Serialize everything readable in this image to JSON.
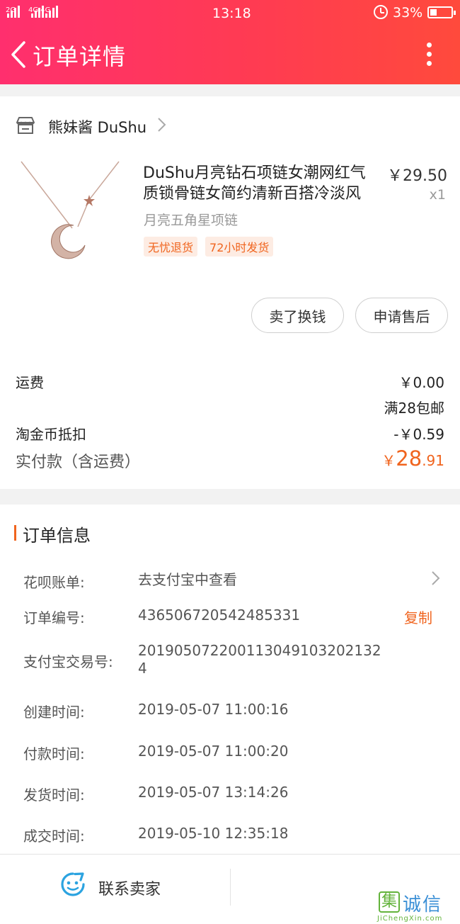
{
  "status_bar": {
    "signal_left": "2G",
    "signal_right": "4G 4G",
    "time": "13:18",
    "battery": "33%",
    "battery_level": 0.33
  },
  "header": {
    "title": "订单详情"
  },
  "shop": {
    "name": "熊妹酱 DuShu"
  },
  "product": {
    "title": "DuShu月亮钻石项链女潮网红气质锁骨链女简约清新百搭冷淡风",
    "price": "￥29.50",
    "quantity": "x1",
    "sku": "月亮五角星项链",
    "tags": [
      "无忧退货",
      "72小时发货"
    ]
  },
  "actions": {
    "sell_label": "卖了换钱",
    "after_sale_label": "申请售后"
  },
  "summary": {
    "shipping_label": "运费",
    "shipping_value": "￥0.00",
    "shipping_note": "满28包邮",
    "coin_label": "淘金币抵扣",
    "coin_value": "-￥0.59",
    "paid_label": "实付款（含运费）",
    "paid_currency": "￥",
    "paid_integer": "28",
    "paid_decimal": ".91"
  },
  "order_info": {
    "section_title": "订单信息",
    "huabei_label": "花呗账单:",
    "huabei_value": "去支付宝中查看",
    "order_no_label": "订单编号:",
    "order_no_value": "436506720542485331",
    "copy_label": "复制",
    "alipay_label": "支付宝交易号:",
    "alipay_value": "2019050722001130491032021324",
    "created_label": "创建时间:",
    "created_value": "2019-05-07 11:00:16",
    "paid_time_label": "付款时间:",
    "paid_time_value": "2019-05-07 11:00:20",
    "shipped_label": "发货时间:",
    "shipped_value": "2019-05-07 13:14:26",
    "completed_label": "成交时间:",
    "completed_value": "2019-05-10 12:35:18"
  },
  "footer": {
    "contact_label": "联系卖家"
  },
  "watermark": {
    "box_char": "集",
    "name": "诚信",
    "url": "JiChengXin.com"
  },
  "colors": {
    "header_gradient_start": "#ff2f6e",
    "header_gradient_end": "#ff4a3c",
    "accent_orange": "#f0641e",
    "contact_icon": "#2ba3e0"
  }
}
